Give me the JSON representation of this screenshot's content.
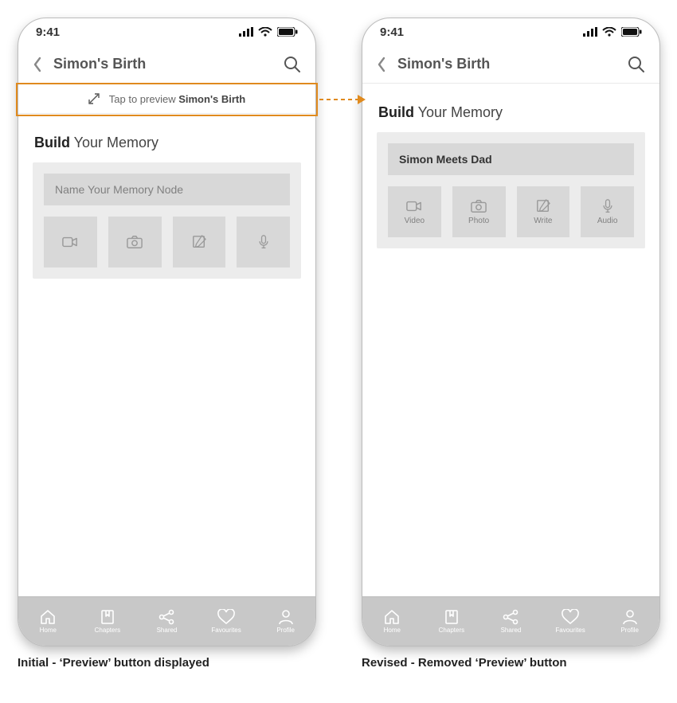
{
  "status": {
    "time": "9:41"
  },
  "title": "Simon's Birth",
  "preview": {
    "prefix": "Tap to preview ",
    "bold": "Simon's Birth"
  },
  "build": {
    "bold": "Build",
    "rest": " Your Memory"
  },
  "left": {
    "namePlaceholder": "Name Your Memory Node",
    "tiles": [
      {
        "name": "video",
        "label": ""
      },
      {
        "name": "photo",
        "label": ""
      },
      {
        "name": "write",
        "label": ""
      },
      {
        "name": "audio",
        "label": ""
      }
    ]
  },
  "right": {
    "nameValue": "Simon Meets Dad",
    "tiles": [
      {
        "name": "video",
        "label": "Video"
      },
      {
        "name": "photo",
        "label": "Photo"
      },
      {
        "name": "write",
        "label": "Write"
      },
      {
        "name": "audio",
        "label": "Audio"
      }
    ]
  },
  "tabs": [
    {
      "name": "home",
      "label": "Home"
    },
    {
      "name": "chapters",
      "label": "Chapters"
    },
    {
      "name": "shared",
      "label": "Shared"
    },
    {
      "name": "favourites",
      "label": "Favourites"
    },
    {
      "name": "profile",
      "label": "Profile"
    }
  ],
  "captions": {
    "left": "Initial - ‘Preview’ button displayed",
    "right": "Revised - Removed ‘Preview’ button"
  },
  "colors": {
    "accent": "#e08a1e"
  }
}
